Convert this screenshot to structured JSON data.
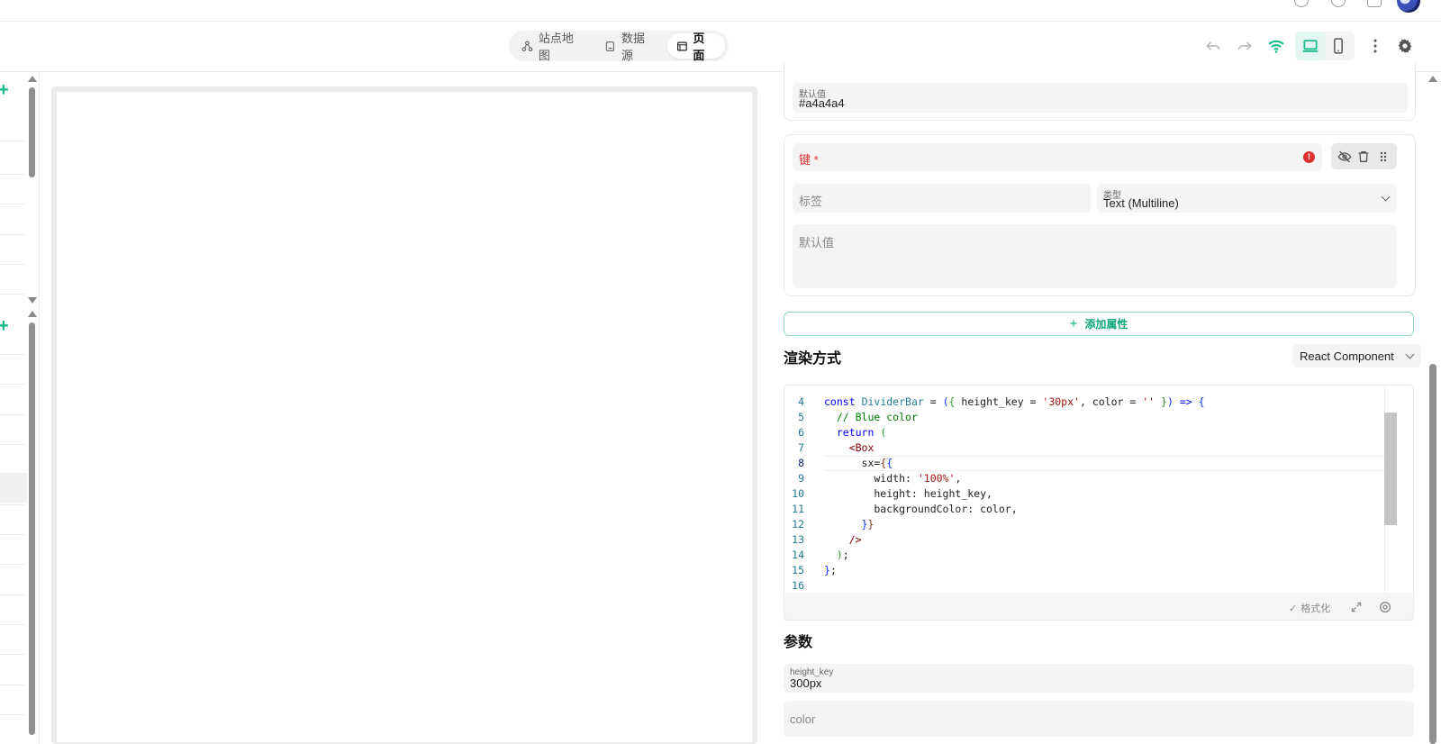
{
  "header": {
    "tabs": [
      {
        "label": "站点地图",
        "icon": "sitemap-icon",
        "active": false
      },
      {
        "label": "数据源",
        "icon": "database-icon",
        "active": false
      },
      {
        "label": "页面",
        "icon": "page-icon",
        "active": true
      }
    ],
    "accent_color": "#12b886"
  },
  "props": {
    "prev_default": {
      "label": "默认值",
      "value": "#a4a4a4"
    },
    "card": {
      "key_placeholder": "键 *",
      "label_placeholder": "标签",
      "type_label": "类型",
      "type_value": "Text (Multiline)",
      "default_placeholder": "默认值"
    },
    "add_label": "添加属性"
  },
  "render": {
    "title": "渲染方式",
    "mode": "React Component"
  },
  "editor": {
    "format_label": "格式化",
    "lines": [
      {
        "n": "4",
        "html": "<span class=\"kw\">const</span> <span class=\"fn\">DividerBar</span> = <span class=\"br1\">(</span><span class=\"br2\">{</span> height_key = <span class=\"str\">'30px'</span>, color = <span class=\"str\">''</span> <span class=\"br2\">}</span><span class=\"br1\">)</span> <span class=\"kw\">=&gt;</span> <span class=\"br1\">{</span>"
      },
      {
        "n": "5",
        "html": "  <span class=\"cm\">// Blue color</span>"
      },
      {
        "n": "6",
        "html": "  <span class=\"kw\">return</span> <span class=\"br2\">(</span>"
      },
      {
        "n": "7",
        "html": "    <span class=\"tag\">&lt;Box</span>"
      },
      {
        "n": "8",
        "html": "      sx=<span class=\"br3\">{</span><span class=\"br1\">{</span>"
      },
      {
        "n": "9",
        "html": "        width: <span class=\"str\">'100%'</span>,"
      },
      {
        "n": "10",
        "html": "        height: height_key,"
      },
      {
        "n": "11",
        "html": "        backgroundColor: color,"
      },
      {
        "n": "12",
        "html": "      <span class=\"br1\">}</span><span class=\"br3\">}</span>"
      },
      {
        "n": "13",
        "html": "    <span class=\"tag\">/&gt;</span>"
      },
      {
        "n": "14",
        "html": "  <span class=\"br2\">)</span>;"
      },
      {
        "n": "15",
        "html": "<span class=\"br1\">}</span>;"
      },
      {
        "n": "16",
        "html": ""
      }
    ]
  },
  "params": {
    "title": "参数",
    "height_key": {
      "label": "height_key",
      "value": "300px"
    },
    "color": {
      "placeholder": "color"
    }
  }
}
